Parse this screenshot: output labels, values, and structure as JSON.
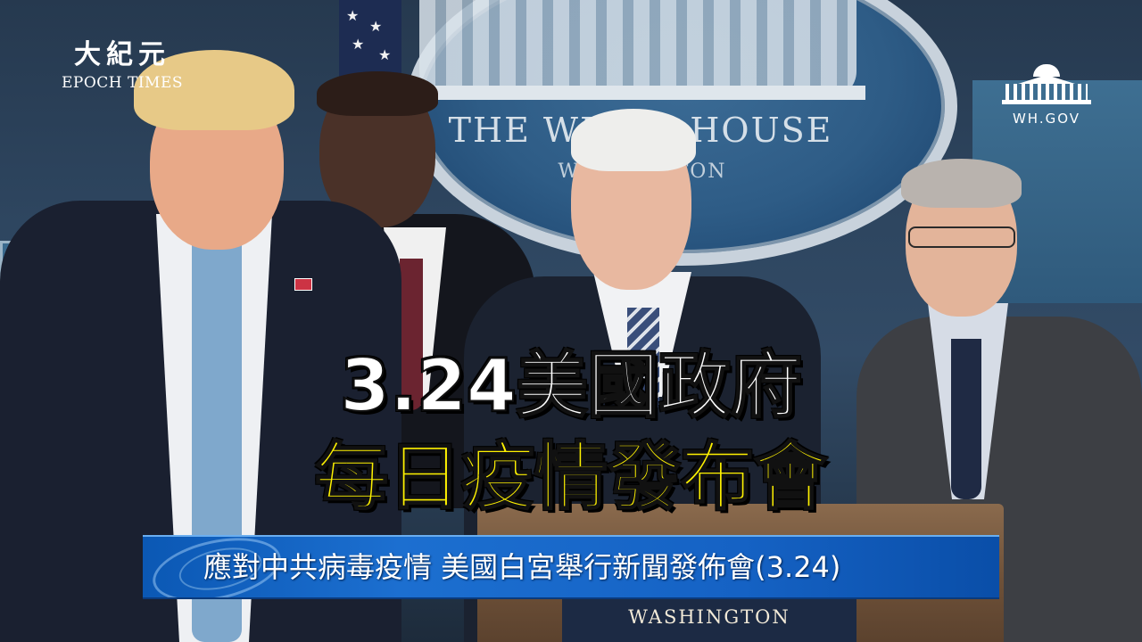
{
  "watermark_left": {
    "name_cn": "大紀元",
    "name_en": "EPOCH TIMES"
  },
  "watermark_right": {
    "icon": "white-house-icon",
    "label": "WH.GOV"
  },
  "backdrop": {
    "seal_text": "THE WHITE HOUSE",
    "seal_subtext": "WASHINGTON"
  },
  "podium": {
    "arc_text": "THE WHITE HOUSE",
    "location": "WASHINGTON"
  },
  "headline": {
    "line1": "3.24美國政府",
    "line2": "每日疫情發布會"
  },
  "ticker": {
    "text": "應對中共病毒疫情 美國白宮舉行新聞發佈會(3.24)"
  },
  "colors": {
    "headline_line1": "#ffffff",
    "headline_line2": "#fff200",
    "ticker_bg": "#1562c4"
  }
}
